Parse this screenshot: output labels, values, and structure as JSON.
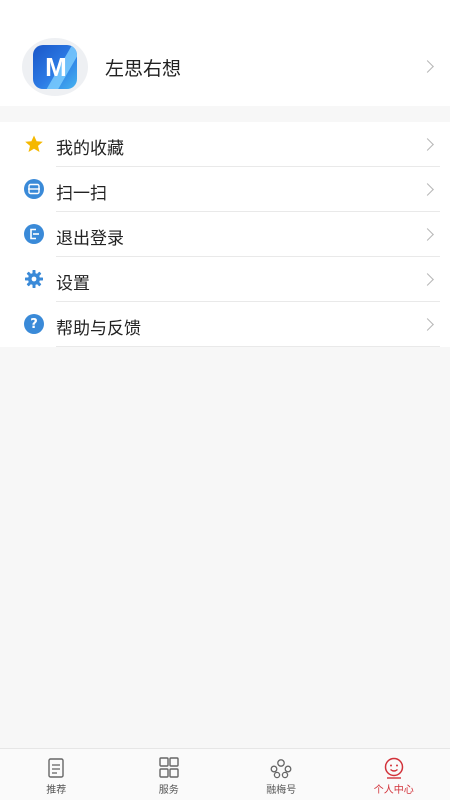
{
  "profile": {
    "name": "左思右想",
    "avatar_letter": "M"
  },
  "menu": {
    "items": [
      {
        "label": "我的收藏",
        "icon": "star-icon"
      },
      {
        "label": "扫一扫",
        "icon": "scan-icon"
      },
      {
        "label": "退出登录",
        "icon": "logout-icon"
      },
      {
        "label": "设置",
        "icon": "gear-icon"
      },
      {
        "label": "帮助与反馈",
        "icon": "help-icon"
      }
    ]
  },
  "tabbar": {
    "tabs": [
      {
        "label": "推荐",
        "icon": "document-icon"
      },
      {
        "label": "服务",
        "icon": "grid-icon"
      },
      {
        "label": "融梅号",
        "icon": "people-icon"
      },
      {
        "label": "个人中心",
        "icon": "smiley-icon",
        "active": true
      }
    ]
  },
  "colors": {
    "accent": "#d2323a",
    "icon_blue": "#3a8ad8",
    "star": "#f5b800"
  }
}
